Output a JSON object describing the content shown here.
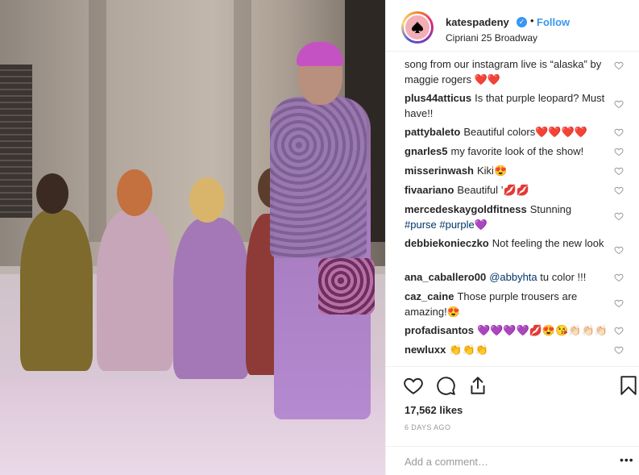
{
  "post": {
    "username": "katespadeny",
    "verified_glyph": "✓",
    "separator": "•",
    "follow_label": "Follow",
    "location": "Cipriani 25 Broadway"
  },
  "comments": [
    {
      "user": "",
      "text": "song from our instagram live is “alaska” by maggie rogers ❤️❤️",
      "partial": true
    },
    {
      "user": "plus44atticus",
      "text": "Is that purple leopard? Must have!!"
    },
    {
      "user": "pattybaleto",
      "text": "Beautiful colors❤️❤️❤️❤️"
    },
    {
      "user": "gnarles5",
      "text": "my favorite look of the show!"
    },
    {
      "user": "misserinwash",
      "text": "Kiki😍"
    },
    {
      "user": "fivaariano",
      "text": "Beautiful ’💋💋"
    },
    {
      "user": "mercedeskaygoldfitness",
      "text": "Stunning",
      "tags": "#purse #purple💜"
    },
    {
      "user": "debbiekonieczko",
      "text": "Not feeling the new look"
    },
    {
      "user": "ana_caballero00",
      "mention": "@abbyhta",
      "text": "tu color !!!"
    },
    {
      "user": "caz_caine",
      "text": "Those purple trousers are amazing!😍"
    },
    {
      "user": "profadisantos",
      "text": "💜💜💜💜💋😍😘👏🏻👏🏻👏🏻"
    },
    {
      "user": "newluxx",
      "text": "👏👏👏"
    }
  ],
  "actions": {
    "likes": "17,562 likes",
    "age": "6 DAYS AGO"
  },
  "add_comment": {
    "placeholder": "Add a comment…",
    "more_label": "•••"
  },
  "icons": [
    "heart-icon",
    "comment-icon",
    "share-icon",
    "bookmark-icon",
    "kate-spade-logo-icon",
    "verified-icon"
  ],
  "colors": {
    "link_blue": "#3897f0",
    "tag_blue": "#003569",
    "text": "#262626",
    "muted": "#999999",
    "logo_pink": "#f3aeb5"
  }
}
